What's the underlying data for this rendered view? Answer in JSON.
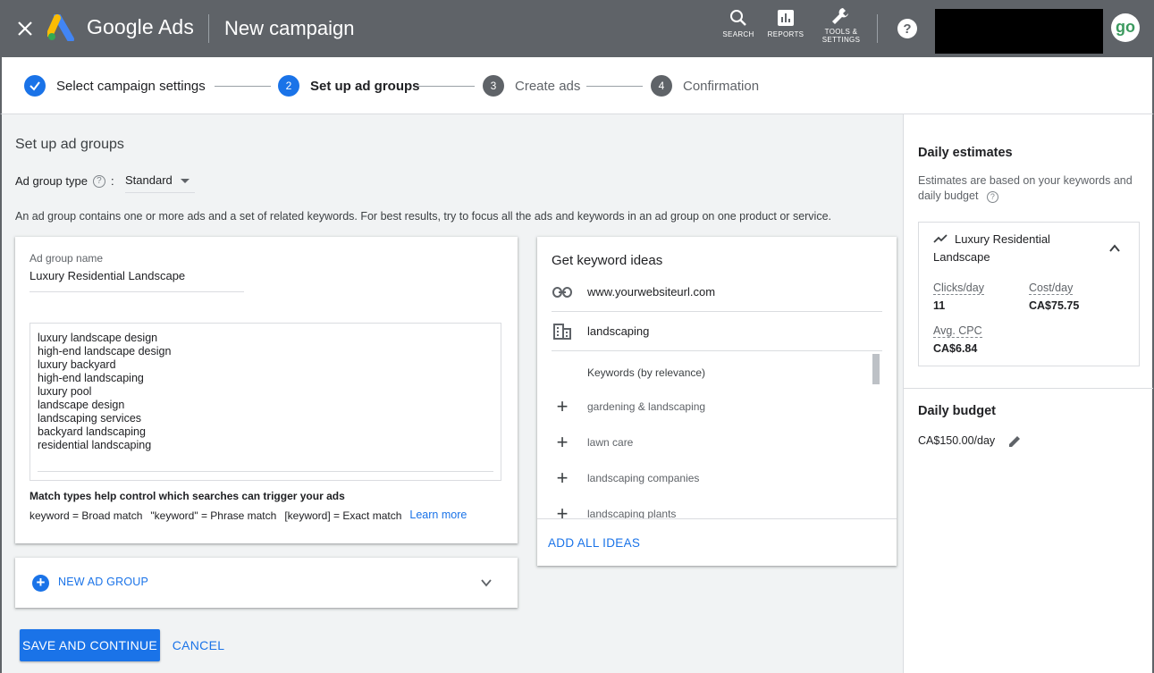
{
  "header": {
    "brand": "Google Ads",
    "title": "New campaign",
    "tools": [
      {
        "label": "SEARCH",
        "icon": "search-icon"
      },
      {
        "label": "REPORTS",
        "icon": "reports-icon"
      },
      {
        "label_line1": "TOOLS &",
        "label_line2": "SETTINGS",
        "icon": "wrench-icon"
      }
    ],
    "avatar_text": "go"
  },
  "stepper": {
    "steps": [
      {
        "label": "Select campaign settings",
        "number": "",
        "state": "done"
      },
      {
        "label": "Set up ad groups",
        "number": "2",
        "state": "active"
      },
      {
        "label": "Create ads",
        "number": "3",
        "state": "upcoming"
      },
      {
        "label": "Confirmation",
        "number": "4",
        "state": "upcoming"
      }
    ]
  },
  "main": {
    "section_title": "Set up ad groups",
    "ad_group_type_label": "Ad group type",
    "ad_group_type_colon": ":",
    "ad_group_type_value": "Standard",
    "intro": "An ad group contains one or more ads and a set of related keywords. For best results, try to focus all the ads and keywords in an ad group on one product or service.",
    "ad_group": {
      "name_label": "Ad group name",
      "name_value": "Luxury Residential Landscape",
      "keywords": [
        "luxury landscape design",
        "high-end landscape design",
        "luxury backyard",
        "high-end landscaping",
        "luxury pool",
        "landscape design",
        "landscaping services",
        "backyard landscaping",
        "residential landscaping"
      ],
      "match_title": "Match types help control which searches can trigger your ads",
      "match_broad": "keyword = Broad match",
      "match_phrase": "\"keyword\" = Phrase match",
      "match_exact": "[keyword] = Exact match",
      "learn_more": "Learn more"
    },
    "new_ad_group": "NEW AD GROUP",
    "save_label": "SAVE AND CONTINUE",
    "cancel_label": "CANCEL"
  },
  "ideas": {
    "title": "Get keyword ideas",
    "url": "www.yourwebsiteurl.com",
    "product": "landscaping",
    "sort_label": "Keywords (by relevance)",
    "items": [
      "gardening & landscaping",
      "lawn care",
      "landscaping companies",
      "landscaping plants"
    ],
    "add_all": "ADD ALL IDEAS"
  },
  "side": {
    "estimates_title": "Daily estimates",
    "estimates_desc": "Estimates are based on your keywords and daily budget",
    "ad_group_name": "Luxury Residential Landscape",
    "clicks_label": "Clicks/day",
    "clicks_value": "11",
    "cost_label": "Cost/day",
    "cost_value": "CA$75.75",
    "cpc_label": "Avg. CPC",
    "cpc_value": "CA$6.84",
    "budget_title": "Daily budget",
    "budget_value": "CA$150.00/day"
  },
  "colors": {
    "topbar": "#5f6368",
    "accent": "#1a73e8",
    "background": "#f1f3f4"
  }
}
